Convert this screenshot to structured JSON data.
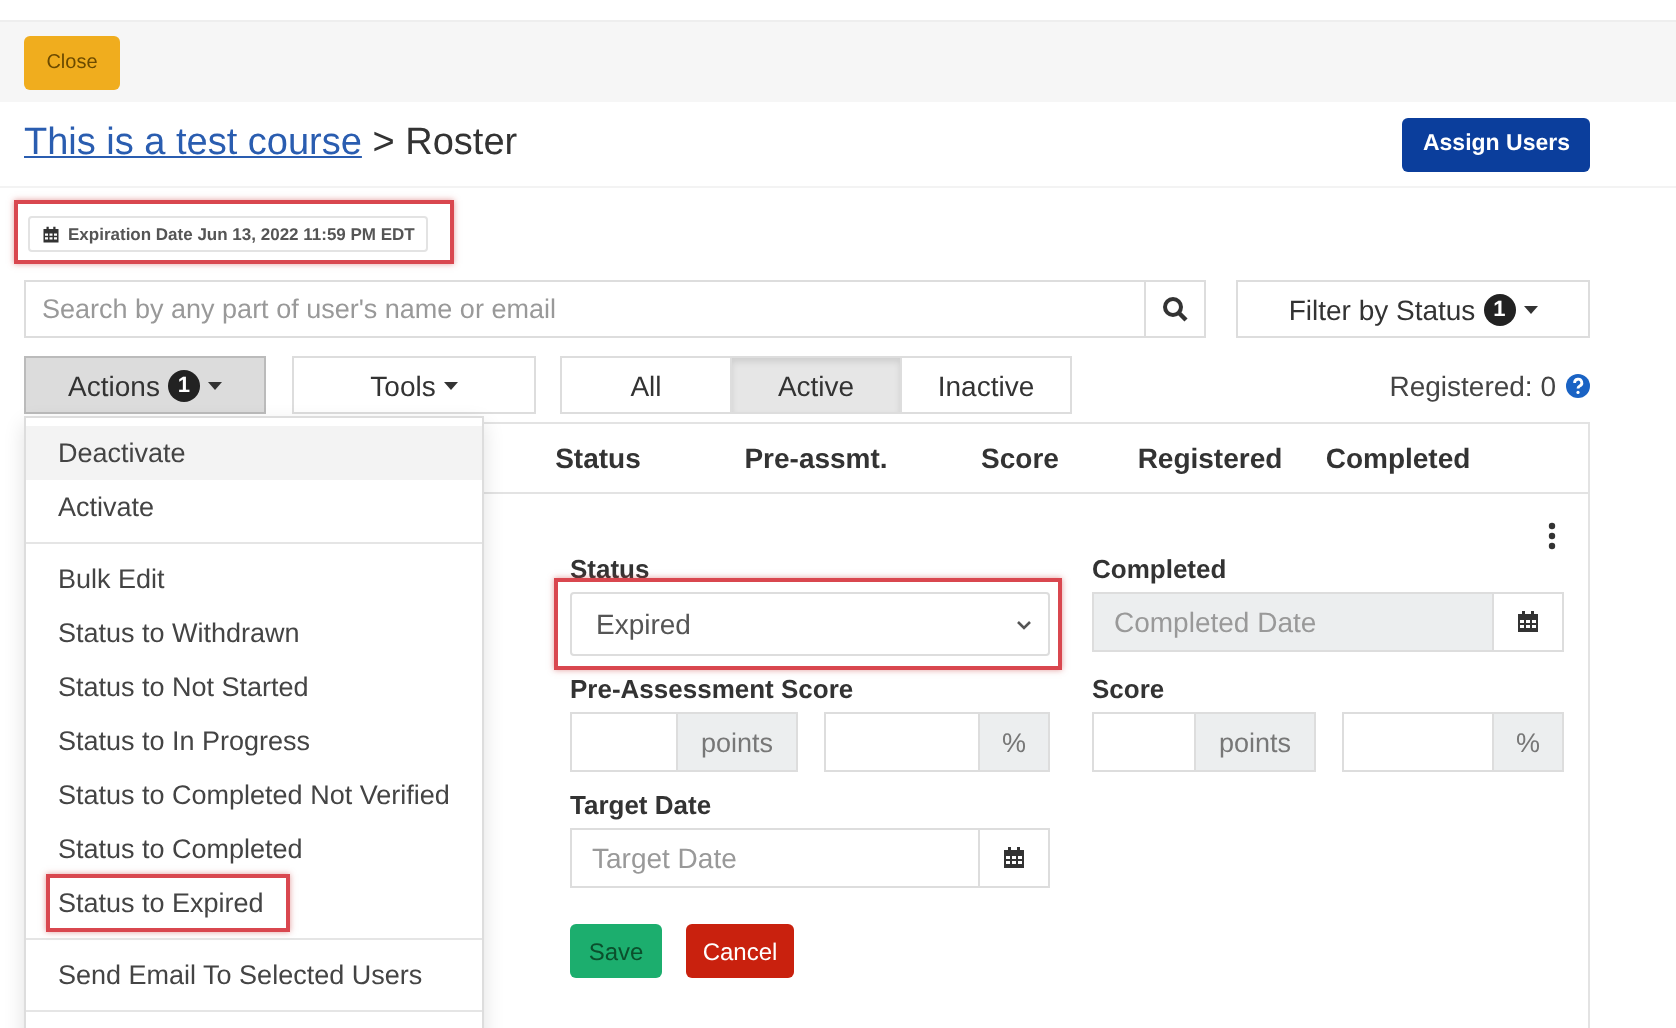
{
  "close_button": "Close",
  "breadcrumb": {
    "link": "This is a test course",
    "separator": ">",
    "current": "Roster"
  },
  "assign_button": "Assign Users",
  "expiration": {
    "text": "Expiration Date Jun 13, 2022 11:59 PM EDT",
    "highlighted": true
  },
  "search": {
    "placeholder": "Search by any part of user's name or email"
  },
  "filter_button": {
    "label": "Filter by Status",
    "count": "1"
  },
  "actions_button": {
    "label": "Actions",
    "count": "1",
    "expanded": true
  },
  "tools_button": {
    "label": "Tools"
  },
  "segments": [
    {
      "label": "All",
      "selected": false
    },
    {
      "label": "Active",
      "selected": true
    },
    {
      "label": "Inactive",
      "selected": false
    }
  ],
  "registered": "Registered: 0",
  "table": {
    "columns": [
      "Status",
      "Pre-assmt.",
      "Score",
      "Registered",
      "Completed"
    ]
  },
  "form": {
    "status": {
      "label": "Status",
      "value": "Expired",
      "highlighted": true
    },
    "completed": {
      "label": "Completed",
      "placeholder": "Completed Date",
      "disabled": true
    },
    "pre_assessment": {
      "label": "Pre-Assessment Score",
      "points_unit": "points",
      "percent_unit": "%"
    },
    "score": {
      "label": "Score",
      "points_unit": "points",
      "percent_unit": "%"
    },
    "target_date": {
      "label": "Target Date",
      "placeholder": "Target Date"
    },
    "save": "Save",
    "cancel": "Cancel"
  },
  "actions_menu": [
    [
      {
        "label": "Deactivate",
        "selected": true,
        "highlighted": false
      },
      {
        "label": "Activate",
        "selected": false,
        "highlighted": false
      }
    ],
    [
      {
        "label": "Bulk Edit",
        "selected": false,
        "highlighted": false
      },
      {
        "label": "Status to Withdrawn",
        "selected": false,
        "highlighted": false
      },
      {
        "label": "Status to Not Started",
        "selected": false,
        "highlighted": false
      },
      {
        "label": "Status to In Progress",
        "selected": false,
        "highlighted": false
      },
      {
        "label": "Status to Completed Not Verified",
        "selected": false,
        "highlighted": false
      },
      {
        "label": "Status to Completed",
        "selected": false,
        "highlighted": false
      },
      {
        "label": "Status to Expired",
        "selected": false,
        "highlighted": true
      }
    ],
    [
      {
        "label": "Send Email To Selected Users",
        "selected": false,
        "highlighted": false
      }
    ]
  ]
}
